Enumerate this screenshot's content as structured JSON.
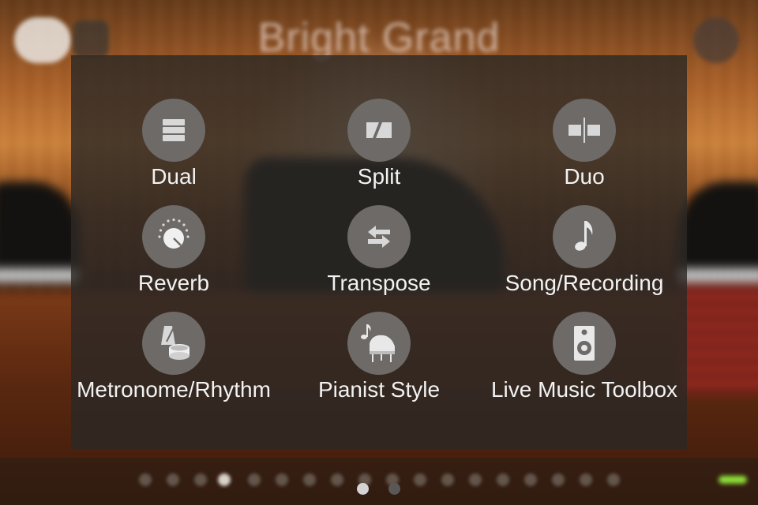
{
  "header": {
    "instrument_name": "Bright Grand"
  },
  "menu": {
    "items": [
      {
        "label": "Dual",
        "icon": "dual-icon"
      },
      {
        "label": "Split",
        "icon": "split-icon"
      },
      {
        "label": "Duo",
        "icon": "duo-icon"
      },
      {
        "label": "Reverb",
        "icon": "reverb-icon"
      },
      {
        "label": "Transpose",
        "icon": "transpose-icon"
      },
      {
        "label": "Song/Recording",
        "icon": "music-note-icon"
      },
      {
        "label": "Metronome/Rhythm",
        "icon": "metronome-icon"
      },
      {
        "label": "Pianist Style",
        "icon": "pianist-style-icon"
      },
      {
        "label": "Live Music Toolbox",
        "icon": "speaker-icon"
      }
    ]
  },
  "pagination": {
    "page_count": 2,
    "current_page": 1
  },
  "colors": {
    "panel_background": "#2a2826",
    "icon_circle": "#6d6a67",
    "icon_glyph": "#d8d8d8",
    "label_text": "#f2f2f2",
    "page_dot_active": "#d4d4d4",
    "page_dot_inactive": "#5a5856",
    "status_light": "#8fe03a"
  }
}
